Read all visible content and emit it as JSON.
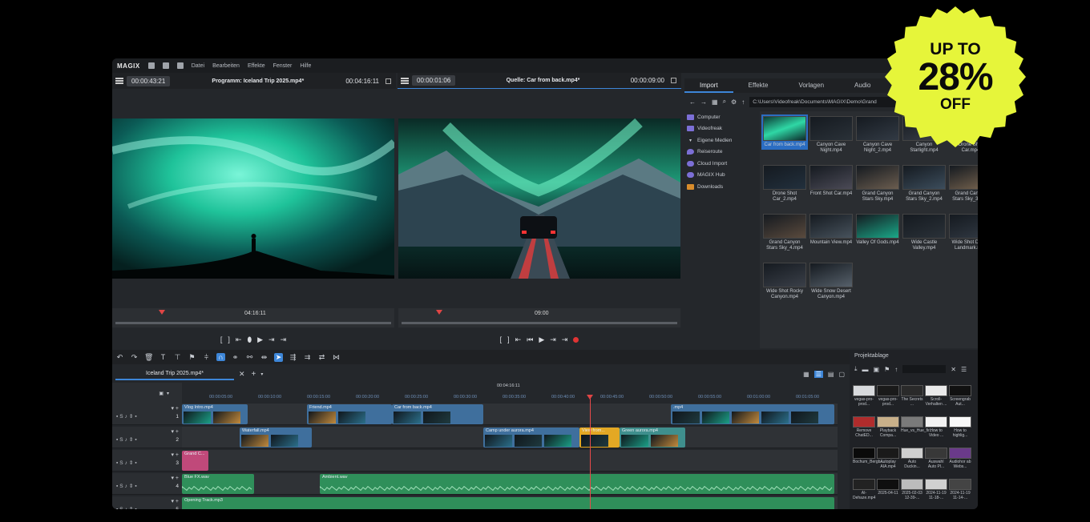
{
  "menubar": {
    "logo": "MAGIX",
    "items": [
      "Datei",
      "Bearbeiten",
      "Effekte",
      "Fenster",
      "Hilfe"
    ]
  },
  "program_monitor": {
    "timecode_left": "00:00:43:21",
    "title": "Programm: Iceland Trip 2025.mp4*",
    "timecode_right": "00:04:16:11",
    "scrub_label": "04:16:11"
  },
  "source_monitor": {
    "timecode_left": "00:00:01:06",
    "title": "Quelle: Car from back.mp4*",
    "timecode_right": "00:00:09:00",
    "scrub_label": "09:00"
  },
  "transport": {
    "program": [
      "[",
      "]",
      "⇤",
      "⬮",
      "▶",
      "⇥",
      "⇥"
    ],
    "source": [
      "[",
      "]",
      "⇤",
      "⏮",
      "▶",
      "⇥",
      "⇥"
    ]
  },
  "media_pool": {
    "tabs": [
      "Import",
      "Effekte",
      "Vorlagen",
      "Audio"
    ],
    "active_tab": "Import",
    "path": "C:\\Users\\Videofreak\\Documents\\MAGIX\\Demo\\Grand",
    "tree": [
      {
        "label": "Computer",
        "color": "#7c6fd6"
      },
      {
        "label": "Videofreak",
        "color": "#7c6fd6"
      },
      {
        "label": "Eigene Medien",
        "color": "#9ca0a6"
      },
      {
        "label": "Reiseroute",
        "color": "#7c6fd6"
      },
      {
        "label": "Cloud Import",
        "color": "#7c6fd6"
      },
      {
        "label": "MAGIX Hub",
        "color": "#7c6fd6"
      },
      {
        "label": "Downloads",
        "color": "#d98c2b"
      }
    ],
    "files": [
      {
        "label": "Car from back.mp4",
        "selected": true
      },
      {
        "label": "Canyon Cave Night.mp4"
      },
      {
        "label": "Canyon Cave Night_2.mp4"
      },
      {
        "label": "Canyon Starlight.mp4"
      },
      {
        "label": "Drone Shot Car.mp4"
      },
      {
        "label": "Drone Shot Car_2.mp4"
      },
      {
        "label": "Front Shot Car.mp4"
      },
      {
        "label": "Grand Canyon Stars Sky.mp4"
      },
      {
        "label": "Grand Canyon Stars Sky_2.mp4"
      },
      {
        "label": "Grand Canyon Stars Sky_3.mp4"
      },
      {
        "label": "Grand Canyon Stars Sky_4.mp4"
      },
      {
        "label": "Mountain View.mp4"
      },
      {
        "label": "Valley Of Gods.mp4"
      },
      {
        "label": "Wide Castle Valley.mp4"
      },
      {
        "label": "Wide Shot Desert Landmark.mp4"
      },
      {
        "label": "Wide Shot Rocky Canyon.mp4"
      },
      {
        "label": "Wide Snow Desert Canyon.mp4"
      }
    ]
  },
  "timeline": {
    "project_tab": "Iceland Trip 2025.mp4*",
    "ruler_top": "00:04:16:11",
    "ruler_ticks": [
      "00:00:05:00",
      "00:00:10:00",
      "00:00:15:00",
      "00:00:20:00",
      "00:00:25:00",
      "00:00:30:00",
      "00:00:35:00",
      "00:00:40:00",
      "00:00:45:00",
      "00:00:50:00",
      "00:00:55:00",
      "00:01:00:00",
      "00:01:05:00"
    ],
    "track_numbers": [
      "1",
      "2",
      "3",
      "4",
      "5"
    ],
    "track1_clips": [
      "Vlog Intro.mp4",
      "Friend.mp4",
      "Car from back.mp4",
      ".mp4"
    ],
    "track2_clips": [
      "Waterfall.mp4",
      "Camp under aurora.mp4",
      "View from...",
      "Green aurora.mp4"
    ],
    "track3_clips": [
      "Grand C..."
    ],
    "track4_clips": [
      "Blue FX.wav",
      "Ambient.wav"
    ],
    "track5_clips": [
      "Opening Track.mp3"
    ]
  },
  "project_panel": {
    "title": "Projektablage",
    "items": [
      "vegas-pro-prod...",
      "vegas-pro-prod...",
      "The Secrets ...",
      "Scroll-Verhalten ...",
      "Screengrab Aut...",
      "Remove ChatED...",
      "Playback Compa...",
      "Hue_vs_Hue_fir...",
      "How to Video ...",
      "How to highlig...",
      "Bochum_Bergb...",
      "Autoplay AIA.mp4",
      "Auto Duckin...",
      "Auswahl Auto Pl...",
      "Audiohor ab Webs...",
      "AI-Dehaze.mp4",
      "2025-04-11",
      "2025-02-03 12-39-...",
      "2024-11-19 11-18-...",
      "2024-11-19 11-14-..."
    ]
  },
  "badge": {
    "line1": "UP TO",
    "line2": "28%",
    "line3": "OFF",
    "color": "#e6f53a"
  }
}
